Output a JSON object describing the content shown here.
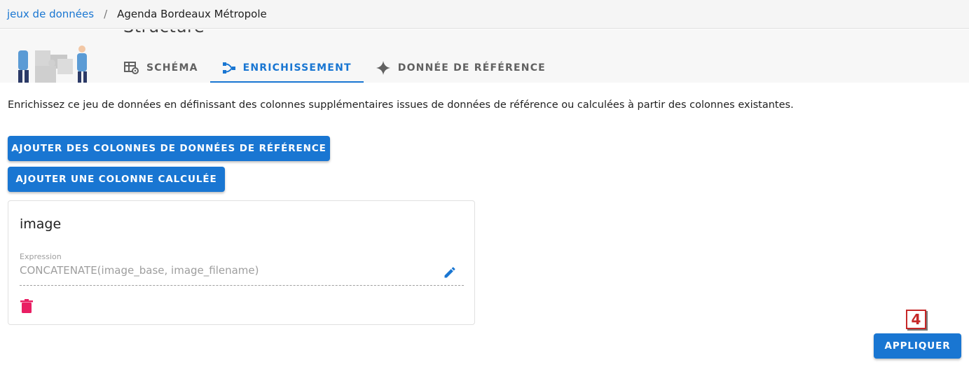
{
  "breadcrumb": {
    "parent": "jeux de données",
    "separator": "/",
    "current": "Agenda Bordeaux Métropole"
  },
  "section": {
    "title": "Structure"
  },
  "tabs": [
    {
      "label": "SCHÉMA",
      "icon": "table-cog-icon",
      "active": false
    },
    {
      "label": "ENRICHISSEMENT",
      "icon": "connection-icon",
      "active": true
    },
    {
      "label": "DONNÉE DE RÉFÉRENCE",
      "icon": "sparkle-icon",
      "active": false
    }
  ],
  "intro_text": "Enrichissez ce jeu de données en définissant des colonnes supplémentaires issues de données de référence ou calculées à partir des colonnes existantes.",
  "buttons": {
    "add_ref_columns": "AJOUTER DES COLONNES DE DONNÉES DE RÉFÉRENCE",
    "add_calc_column": "AJOUTER UNE COLONNE CALCULÉE",
    "apply": "APPLIQUER"
  },
  "column_card": {
    "title": "image",
    "expression_label": "Expression",
    "expression_value": "CONCATENATE(image_base, image_filename)"
  },
  "step_marker": "4",
  "colors": {
    "primary": "#1976d2",
    "delete": "#e91e63",
    "marker": "#c62828"
  }
}
